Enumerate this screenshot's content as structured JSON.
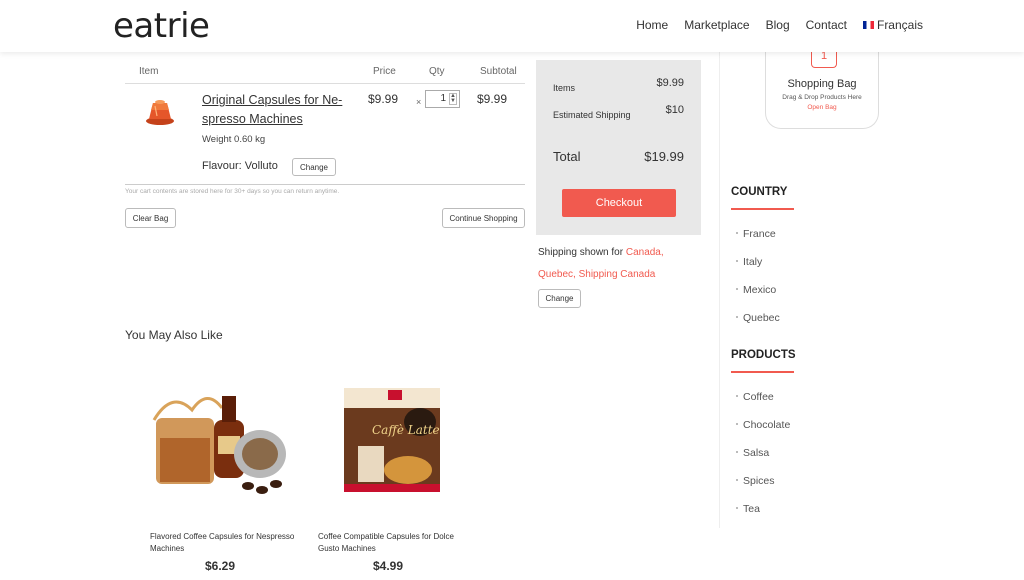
{
  "header": {
    "logo": "eatrie",
    "nav": [
      "Home",
      "Marketplace",
      "Blog",
      "Contact"
    ],
    "language": "Français"
  },
  "cart": {
    "columns": {
      "item": "Item",
      "price": "Price",
      "qty": "Qty",
      "subtotal": "Subtotal"
    },
    "product": {
      "name": "Original Capsules for Ne-spresso Machines",
      "weight": "Weight 0.60 kg",
      "flavour": "Flavour: Volluto",
      "price": "$9.99",
      "qty": "1",
      "subtotal": "$9.99"
    },
    "change_label": "Change",
    "times": "×",
    "note": "Your cart contents are stored here for 30+ days so you can return anytime.",
    "clear_label": "Clear Bag",
    "continue_label": "Continue Shopping"
  },
  "summary": {
    "items_label": "Items",
    "items_value": "$9.99",
    "shipping_label": "Estimated Shipping",
    "shipping_value": "$10",
    "total_label": "Total",
    "total_value": "$19.99",
    "checkout_label": "Checkout",
    "ship_prefix": "Shipping shown for ",
    "ship_country": "Canada,",
    "ship_region": "Quebec,",
    "ship_method": "Shipping Canada",
    "change_label": "Change"
  },
  "recommend": {
    "title": "You May Also Like",
    "items": [
      {
        "name": "Flavored Coffee Capsules for Nespresso Machines",
        "price": "$6.29"
      },
      {
        "name": "Coffee Compatible Capsules for Dolce Gusto Machines",
        "price": "$4.99"
      }
    ]
  },
  "bag": {
    "count": "1",
    "title": "Shopping Bag",
    "subtitle": "Drag & Drop Products Here",
    "open": "Open Bag"
  },
  "sidebar": {
    "country_title": "COUNTRY",
    "countries": [
      "France",
      "Italy",
      "Mexico",
      "Quebec"
    ],
    "products_title": "PRODUCTS",
    "products": [
      "Coffee",
      "Chocolate",
      "Salsa",
      "Spices",
      "Tea"
    ]
  },
  "colors": {
    "accent": "#f15a4f",
    "summary_bg": "#e8e8e8"
  }
}
